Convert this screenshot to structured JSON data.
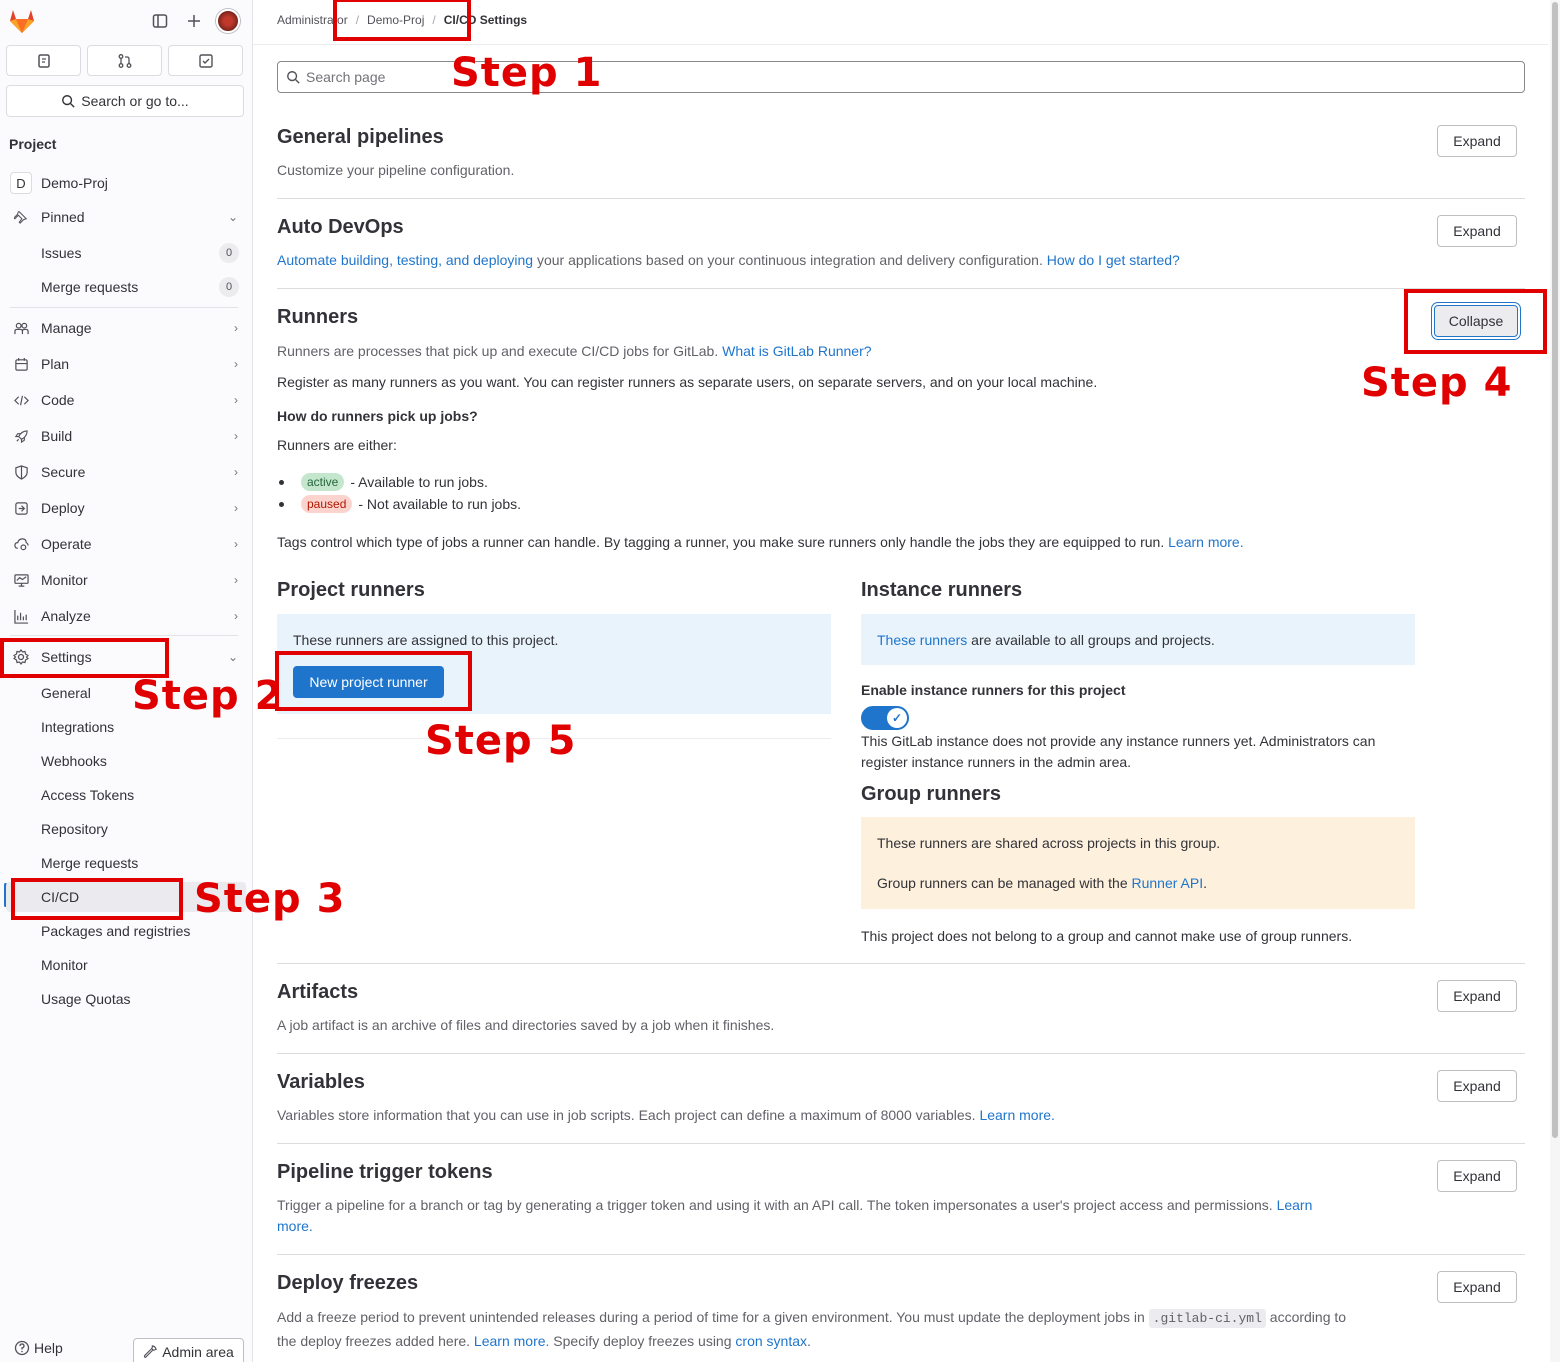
{
  "sidebar": {
    "quick_buttons": [
      "issues-icon",
      "merge-request-icon",
      "todo-icon"
    ],
    "search_label": "Search or go to...",
    "section_label": "Project",
    "project": {
      "initial": "D",
      "name": "Demo-Proj"
    },
    "pinned": {
      "label": "Pinned",
      "items": [
        {
          "label": "Issues",
          "count": "0"
        },
        {
          "label": "Merge requests",
          "count": "0"
        }
      ]
    },
    "groups": [
      {
        "label": "Manage",
        "icon": "users-icon"
      },
      {
        "label": "Plan",
        "icon": "planning-icon"
      },
      {
        "label": "Code",
        "icon": "code-icon"
      },
      {
        "label": "Build",
        "icon": "rocket-icon"
      },
      {
        "label": "Secure",
        "icon": "shield-icon"
      },
      {
        "label": "Deploy",
        "icon": "deployments-icon"
      },
      {
        "label": "Operate",
        "icon": "cloud-gear-icon"
      },
      {
        "label": "Monitor",
        "icon": "monitor-icon"
      },
      {
        "label": "Analyze",
        "icon": "chart-icon"
      }
    ],
    "settings": {
      "label": "Settings",
      "items": [
        "General",
        "Integrations",
        "Webhooks",
        "Access Tokens",
        "Repository",
        "Merge requests",
        "CI/CD",
        "Packages and registries",
        "Monitor",
        "Usage Quotas"
      ]
    },
    "help_label": "Help",
    "admin_label": "Admin area"
  },
  "breadcrumb": [
    "Administrator",
    "Demo-Proj",
    "CI/CD Settings"
  ],
  "search": {
    "placeholder": "Search page"
  },
  "sections": {
    "general_pipelines": {
      "title": "General pipelines",
      "desc": "Customize your pipeline configuration.",
      "button": "Expand"
    },
    "auto_devops": {
      "title": "Auto DevOps",
      "link1": "Automate building, testing, and deploying",
      "desc": " your applications based on your continuous integration and delivery configuration. ",
      "link2": "How do I get started?",
      "button": "Expand"
    },
    "runners": {
      "title": "Runners",
      "button": "Collapse",
      "desc": "Runners are processes that pick up and execute CI/CD jobs for GitLab. ",
      "desc_link": "What is GitLab Runner?",
      "register": "Register as many runners as you want. You can register runners as separate users, on separate servers, and on your local machine.",
      "how_heading": "How do runners pick up jobs?",
      "either": "Runners are either:",
      "active_badge": "active",
      "active_text": "- Available to run jobs.",
      "paused_badge": "paused",
      "paused_text": "- Not available to run jobs.",
      "tags_text": "Tags control which type of jobs a runner can handle. By tagging a runner, you make sure runners only handle the jobs they are equipped to run. ",
      "tags_link": "Learn more.",
      "project_runners": {
        "title": "Project runners",
        "text": "These runners are assigned to this project.",
        "button": "New project runner"
      },
      "instance_runners": {
        "title": "Instance runners",
        "link": "These runners",
        "text": " are available to all groups and projects.",
        "toggle_label": "Enable instance runners for this project",
        "note_line1": "This GitLab instance does not provide any instance runners yet. Administrators can",
        "note_line2": "register instance runners in the admin area."
      },
      "group_runners": {
        "title": "Group runners",
        "text1": "These runners are shared across projects in this group.",
        "text2": "Group runners can be managed with the ",
        "link": "Runner API",
        "text2_end": ".",
        "note": "This project does not belong to a group and cannot make use of group runners."
      }
    },
    "artifacts": {
      "title": "Artifacts",
      "desc": "A job artifact is an archive of files and directories saved by a job when it finishes.",
      "button": "Expand"
    },
    "variables": {
      "title": "Variables",
      "desc": "Variables store information that you can use in job scripts. Each project can define a maximum of 8000 variables. ",
      "link": "Learn more.",
      "button": "Expand"
    },
    "trigger_tokens": {
      "title": "Pipeline trigger tokens",
      "desc": "Trigger a pipeline for a branch or tag by generating a trigger token and using it with an API call. The token impersonates a user's project access and permissions. ",
      "link1": "Learn",
      "link2": "more.",
      "button": "Expand"
    },
    "deploy_freezes": {
      "title": "Deploy freezes",
      "desc1": "Add a freeze period to prevent unintended releases during a period of time for a given environment. You must update the deployment jobs in ",
      "code": ".gitlab-ci.yml",
      "desc1_end": " according to",
      "desc2": "the deploy freezes added here. ",
      "link1": "Learn more.",
      "desc3": " Specify deploy freezes using ",
      "link2": "cron syntax",
      "desc3_end": ".",
      "button": "Expand"
    }
  },
  "annotations": [
    "Step 1",
    "Step 2",
    "Step 3",
    "Step 4",
    "Step 5"
  ],
  "colors": {
    "accent": "#1f75cb",
    "annotation": "#e00000",
    "active_badge": "#c3e6cd",
    "paused_badge": "#fdd4cd"
  }
}
